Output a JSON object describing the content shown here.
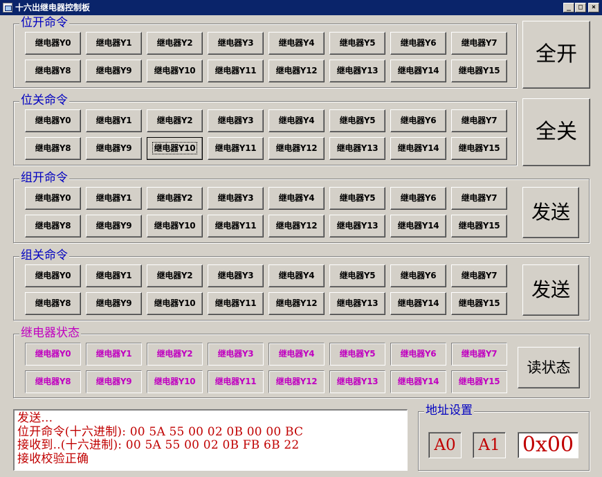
{
  "window": {
    "title": "十六出继电器控制板",
    "min": "_",
    "max": "□",
    "close": "×"
  },
  "relay_labels": [
    "继电器Y0",
    "继电器Y1",
    "继电器Y2",
    "继电器Y3",
    "继电器Y4",
    "继电器Y5",
    "继电器Y6",
    "继电器Y7",
    "继电器Y8",
    "继电器Y9",
    "继电器Y10",
    "继电器Y11",
    "继电器Y12",
    "继电器Y13",
    "继电器Y14",
    "继电器Y15"
  ],
  "groups": {
    "bit_on": {
      "title": "位开命令"
    },
    "bit_off": {
      "title": "位关命令"
    },
    "group_on": {
      "title": "组开命令"
    },
    "group_off": {
      "title": "组关命令"
    },
    "status": {
      "title": "继电器状态"
    },
    "address": {
      "title": "地址设置"
    }
  },
  "buttons": {
    "all_on": "全开",
    "all_off": "全关",
    "send_on": "发送",
    "send_off": "发送",
    "read_status": "读状态"
  },
  "focused_button": "bit_off.Y10",
  "log_lines": [
    "发送...",
    "位开命令(十六进制): 00 5A 55 00 02 0B 00 00 BC",
    "接收到..(十六进制): 00 5A 55 00 02 0B FB 6B 22",
    "接收校验正确"
  ],
  "address": {
    "a0": "A0",
    "a1": "A1",
    "value": "0x00"
  },
  "colors": {
    "title_bar": "#0a246a",
    "group_title_blue": "#0000c0",
    "status_title": "#c000c0",
    "status_text": "#c000c0",
    "log_text": "#c00000",
    "face": "#d4d0c8"
  }
}
